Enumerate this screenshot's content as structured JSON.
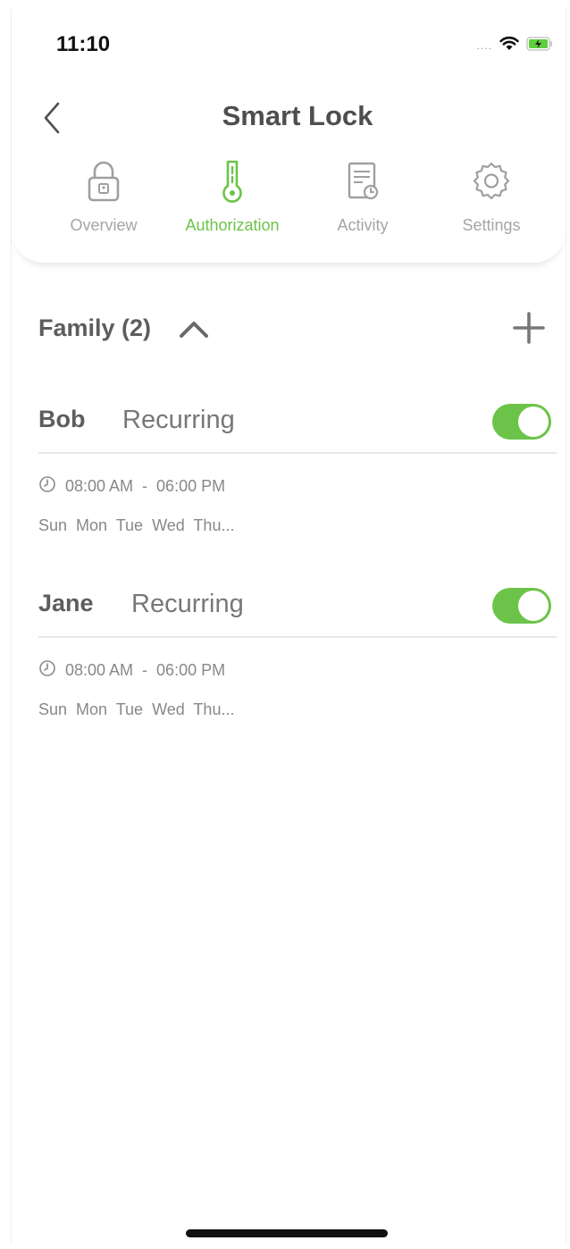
{
  "status_bar": {
    "time": "11:10",
    "signal": "....",
    "icons": [
      "wifi-icon",
      "battery-charging-icon"
    ],
    "battery_color": "#5fcf3e"
  },
  "header": {
    "title": "Smart Lock",
    "back_icon": "chevron-left-icon"
  },
  "tabs": [
    {
      "label": "Overview",
      "icon": "lock-icon",
      "active": false
    },
    {
      "label": "Authorization",
      "icon": "key-icon",
      "active": true
    },
    {
      "label": "Activity",
      "icon": "activity-log-icon",
      "active": false
    },
    {
      "label": "Settings",
      "icon": "gear-icon",
      "active": false
    }
  ],
  "group": {
    "title": "Family (2)",
    "caret_icon": "chevron-up-icon",
    "add_icon": "plus-icon"
  },
  "members": [
    {
      "name": "Bob",
      "type": "Recurring",
      "enabled": true,
      "time": "08:00 AM  -  06:00 PM",
      "days": "Sun  Mon  Tue  Wed  Thu..."
    },
    {
      "name": "Jane",
      "type": "Recurring",
      "enabled": true,
      "time": "08:00 AM  -  06:00 PM",
      "days": "Sun  Mon  Tue  Wed  Thu..."
    }
  ],
  "colors": {
    "accent": "#6cc34a",
    "inactive": "#a5a5a5",
    "text": "#5d5d5d"
  }
}
